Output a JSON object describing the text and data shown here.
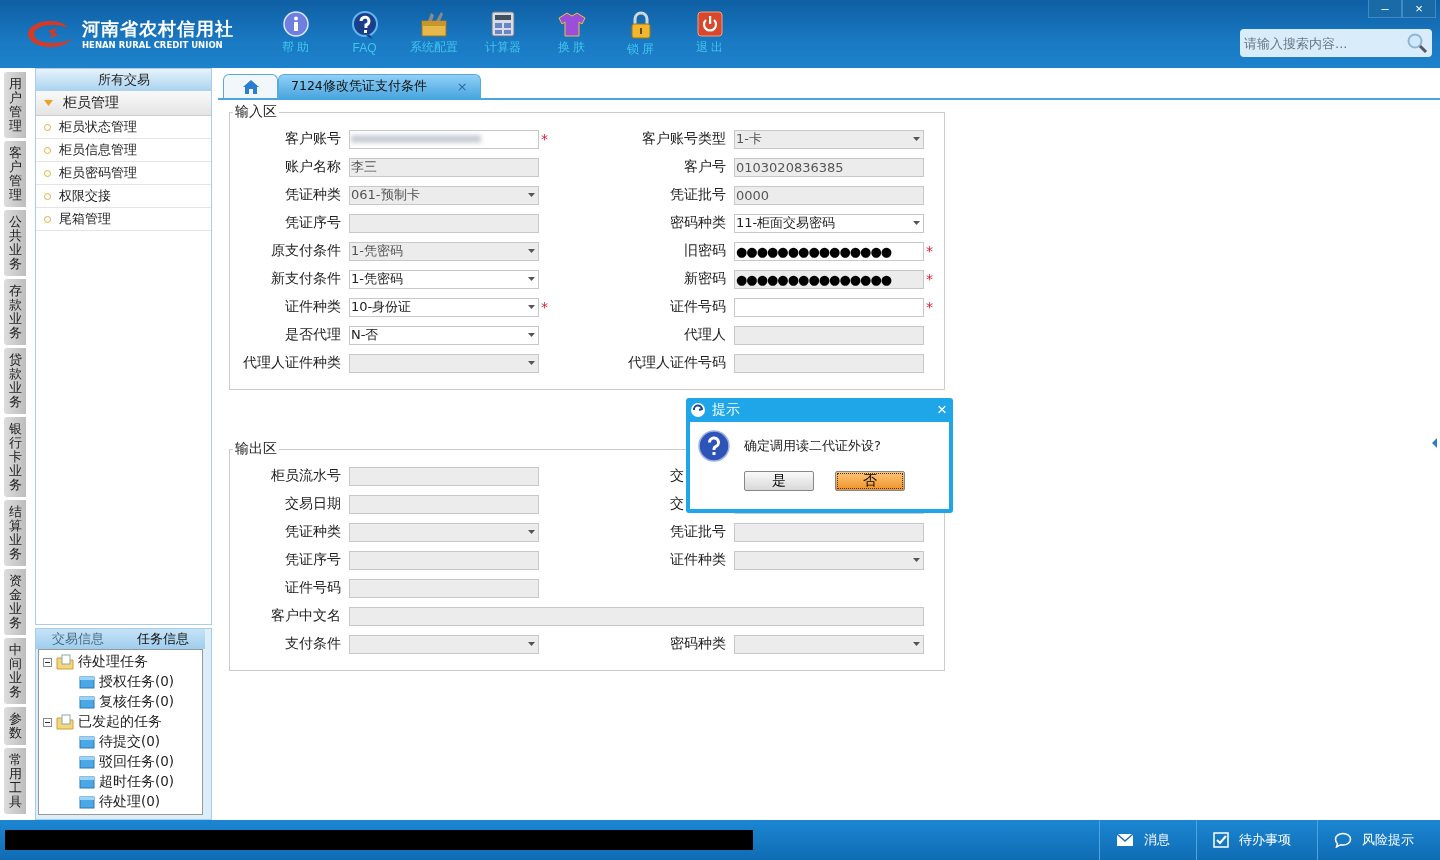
{
  "header": {
    "logo_title": "河南省农村信用社",
    "logo_subtitle": "HENAN RURAL CREDIT UNION",
    "toolbar": [
      {
        "kind": "info",
        "label": "帮 助"
      },
      {
        "kind": "help",
        "label": "FAQ"
      },
      {
        "kind": "toolbox",
        "label": "系统配置"
      },
      {
        "kind": "calculator",
        "label": "计算器"
      },
      {
        "kind": "shirt",
        "label": "换 肤"
      },
      {
        "kind": "lock",
        "label": "锁 屏"
      },
      {
        "kind": "power",
        "label": "退 出"
      }
    ],
    "search": {
      "placeholder": "请输入搜索内容..."
    },
    "window_controls": [
      "–",
      "×"
    ]
  },
  "side_tabs": [
    "用户管理",
    "客户管理",
    "公共业务",
    "存款业务",
    "贷款业务",
    "银行卡业务",
    "结算业务",
    "资金业务",
    "中间业务",
    "参数",
    "常用工具"
  ],
  "sidebar": {
    "title": "所有交易",
    "groups": [
      {
        "label": "柜员管理",
        "expanded": true,
        "items": [
          "柜员状态管理",
          "柜员信息管理",
          "柜员密码管理",
          "权限交接",
          "尾箱管理"
        ]
      }
    ]
  },
  "info_panel": {
    "tabs": [
      {
        "label": "交易信息",
        "selected": false
      },
      {
        "label": "任务信息",
        "selected": true
      }
    ],
    "tree": [
      {
        "label": "待处理任务",
        "expanded": true,
        "children": [
          {
            "label": "授权任务(0)"
          },
          {
            "label": "复核任务(0)"
          }
        ]
      },
      {
        "label": "已发起的任务",
        "expanded": true,
        "children": [
          {
            "label": "待提交(0)"
          },
          {
            "label": "驳回任务(0)"
          },
          {
            "label": "超时任务(0)"
          },
          {
            "label": "待处理(0)"
          }
        ]
      }
    ]
  },
  "tabs": [
    {
      "kind": "home",
      "selected": false
    },
    {
      "kind": "page",
      "label": "7124修改凭证支付条件",
      "close": "×",
      "selected": true
    }
  ],
  "input_area": {
    "title": "输入区",
    "rows": [
      [
        {
          "label": "客户账号",
          "kind": "blurred",
          "editable": true,
          "required_mark": "*"
        },
        {
          "label": "客户账号类型",
          "kind": "select",
          "value": "1-卡",
          "editable": false
        }
      ],
      [
        {
          "label": "账户名称",
          "kind": "text",
          "value": "李三",
          "editable": false
        },
        {
          "label": "客户号",
          "kind": "text",
          "value": "0103020836385",
          "editable": false
        }
      ],
      [
        {
          "label": "凭证种类",
          "kind": "select",
          "value": "061-预制卡",
          "editable": false
        },
        {
          "label": "凭证批号",
          "kind": "text",
          "value": "0000",
          "editable": false
        }
      ],
      [
        {
          "label": "凭证序号",
          "kind": "text",
          "editable": false
        },
        {
          "label": "密码种类",
          "kind": "select",
          "value": "11-柜面交易密码",
          "editable": true
        }
      ],
      [
        {
          "label": "原支付条件",
          "kind": "select",
          "value": "1-凭密码",
          "editable": false
        },
        {
          "label": "旧密码",
          "kind": "password",
          "value": "●●●●●●●●●●●●●●●",
          "editable": true,
          "required_mark": "*"
        }
      ],
      [
        {
          "label": "新支付条件",
          "kind": "select",
          "value": "1-凭密码",
          "editable": true
        },
        {
          "label": "新密码",
          "kind": "password",
          "value": "●●●●●●●●●●●●●●●",
          "editable": false,
          "required_mark": "*"
        }
      ],
      [
        {
          "label": "证件种类",
          "kind": "select",
          "value": "10-身份证",
          "editable": true,
          "required_mark": "*"
        },
        {
          "label": "证件号码",
          "kind": "text",
          "editable": true,
          "required_mark": "*"
        }
      ],
      [
        {
          "label": "是否代理",
          "kind": "select",
          "value": "N-否",
          "editable": true
        },
        {
          "label": "代理人",
          "kind": "text",
          "editable": false
        }
      ],
      [
        {
          "label": "代理人证件种类",
          "kind": "select",
          "editable": false
        },
        {
          "label": "代理人证件号码",
          "kind": "text",
          "editable": false
        }
      ]
    ]
  },
  "output_area": {
    "title": "输出区",
    "rows": [
      [
        {
          "label": "柜员流水号",
          "kind": "text"
        },
        {
          "label": "交",
          "kind": "covered"
        }
      ],
      [
        {
          "label": "交易日期",
          "kind": "text"
        },
        {
          "label": "交",
          "kind": "text_covered"
        }
      ],
      [
        {
          "label": "凭证种类",
          "kind": "select"
        },
        {
          "label": "凭证批号",
          "kind": "text"
        }
      ],
      [
        {
          "label": "凭证序号",
          "kind": "text"
        },
        {
          "label": "证件种类",
          "kind": "select"
        }
      ],
      [
        {
          "label": "证件号码",
          "kind": "text"
        }
      ],
      [
        {
          "label": "客户中文名",
          "kind": "wide"
        }
      ],
      [
        {
          "label": "支付条件",
          "kind": "select"
        },
        {
          "label": "密码种类",
          "kind": "select"
        }
      ]
    ]
  },
  "dialog": {
    "title": "提示",
    "close": "×",
    "message": "确定调用读二代证外设?",
    "buttons": [
      {
        "label": "是",
        "focused": false
      },
      {
        "label": "否",
        "focused": true
      }
    ]
  },
  "status_bar": {
    "items": [
      {
        "kind": "mail",
        "label": "消息"
      },
      {
        "kind": "check",
        "label": "待办事项"
      },
      {
        "kind": "chat",
        "label": "风险提示"
      }
    ]
  }
}
